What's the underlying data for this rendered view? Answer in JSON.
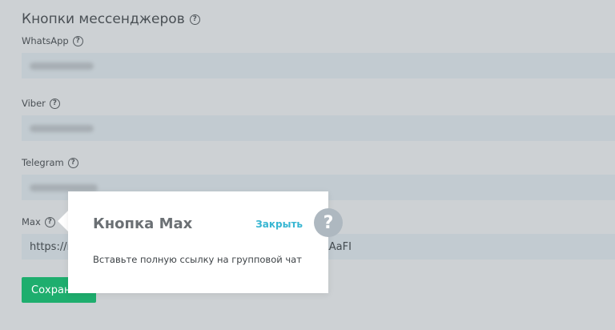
{
  "section": {
    "title": "Кнопки мессенджеров",
    "help_icon": "question-circle-icon"
  },
  "fields": {
    "whatsapp": {
      "label": "WhatsApp",
      "value_hidden": true
    },
    "viber": {
      "label": "Viber",
      "value_hidden": true
    },
    "telegram": {
      "label": "Telegram",
      "value_hidden": true
    },
    "max": {
      "label": "Max",
      "value_start": "https://r",
      "value_end": "tP1LAaFI"
    }
  },
  "save_button": {
    "label": "Сохранить"
  },
  "popup": {
    "title": "Кнопка Max",
    "close_label": "Закрыть",
    "text": "Вставьте полную ссылку на групповой чат",
    "help_symbol": "?"
  },
  "colors": {
    "accent_link": "#37b6d2",
    "save_button": "#1eae6e",
    "overlay_bg": "#cdd1d4"
  }
}
